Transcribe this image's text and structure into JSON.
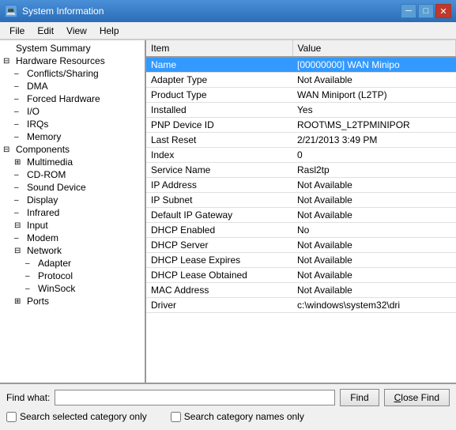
{
  "titleBar": {
    "icon": "💻",
    "title": "System Information",
    "minimizeLabel": "─",
    "maximizeLabel": "□",
    "closeLabel": "✕"
  },
  "menuBar": {
    "items": [
      "File",
      "Edit",
      "View",
      "Help"
    ]
  },
  "tree": {
    "items": [
      {
        "id": "system-summary",
        "label": "System Summary",
        "indent": 1,
        "icon": ""
      },
      {
        "id": "hardware-resources",
        "label": "Hardware Resources",
        "indent": 1,
        "icon": "⊟"
      },
      {
        "id": "conflicts-sharing",
        "label": "Conflicts/Sharing",
        "indent": 2,
        "icon": "–"
      },
      {
        "id": "dma",
        "label": "DMA",
        "indent": 2,
        "icon": "–"
      },
      {
        "id": "forced-hardware",
        "label": "Forced Hardware",
        "indent": 2,
        "icon": "–"
      },
      {
        "id": "io",
        "label": "I/O",
        "indent": 2,
        "icon": "–"
      },
      {
        "id": "irqs",
        "label": "IRQs",
        "indent": 2,
        "icon": "–"
      },
      {
        "id": "memory",
        "label": "Memory",
        "indent": 2,
        "icon": "–"
      },
      {
        "id": "components",
        "label": "Components",
        "indent": 1,
        "icon": "⊟"
      },
      {
        "id": "multimedia",
        "label": "Multimedia",
        "indent": 2,
        "icon": "⊞"
      },
      {
        "id": "cd-rom",
        "label": "CD-ROM",
        "indent": 2,
        "icon": "–"
      },
      {
        "id": "sound-device",
        "label": "Sound Device",
        "indent": 2,
        "icon": "–"
      },
      {
        "id": "display",
        "label": "Display",
        "indent": 2,
        "icon": "–"
      },
      {
        "id": "infrared",
        "label": "Infrared",
        "indent": 2,
        "icon": "–"
      },
      {
        "id": "input",
        "label": "Input",
        "indent": 2,
        "icon": "⊟"
      },
      {
        "id": "modem",
        "label": "Modem",
        "indent": 2,
        "icon": "–"
      },
      {
        "id": "network",
        "label": "Network",
        "indent": 2,
        "icon": "⊟"
      },
      {
        "id": "adapter",
        "label": "Adapter",
        "indent": 3,
        "icon": "–"
      },
      {
        "id": "protocol",
        "label": "Protocol",
        "indent": 3,
        "icon": "–"
      },
      {
        "id": "winsock",
        "label": "WinSock",
        "indent": 3,
        "icon": "–"
      },
      {
        "id": "ports",
        "label": "Ports",
        "indent": 2,
        "icon": "⊞"
      }
    ]
  },
  "table": {
    "columns": [
      {
        "id": "item",
        "label": "Item"
      },
      {
        "id": "value",
        "label": "Value"
      }
    ],
    "rows": [
      {
        "item": "Name",
        "value": "[00000000] WAN Minipo",
        "highlighted": true
      },
      {
        "item": "Adapter Type",
        "value": "Not Available",
        "highlighted": false
      },
      {
        "item": "Product Type",
        "value": "WAN Miniport (L2TP)",
        "highlighted": false
      },
      {
        "item": "Installed",
        "value": "Yes",
        "highlighted": false
      },
      {
        "item": "PNP Device ID",
        "value": "ROOT\\MS_L2TPMINIPOR",
        "highlighted": false
      },
      {
        "item": "Last Reset",
        "value": "2/21/2013 3:49 PM",
        "highlighted": false
      },
      {
        "item": "Index",
        "value": "0",
        "highlighted": false
      },
      {
        "item": "Service Name",
        "value": "Rasl2tp",
        "highlighted": false
      },
      {
        "item": "IP Address",
        "value": "Not Available",
        "highlighted": false
      },
      {
        "item": "IP Subnet",
        "value": "Not Available",
        "highlighted": false
      },
      {
        "item": "Default IP Gateway",
        "value": "Not Available",
        "highlighted": false
      },
      {
        "item": "DHCP Enabled",
        "value": "No",
        "highlighted": false
      },
      {
        "item": "DHCP Server",
        "value": "Not Available",
        "highlighted": false
      },
      {
        "item": "DHCP Lease Expires",
        "value": "Not Available",
        "highlighted": false
      },
      {
        "item": "DHCP Lease Obtained",
        "value": "Not Available",
        "highlighted": false
      },
      {
        "item": "MAC Address",
        "value": "Not Available",
        "highlighted": false
      },
      {
        "item": "Driver",
        "value": "c:\\windows\\system32\\dri",
        "highlighted": false
      }
    ]
  },
  "findBar": {
    "findWhatLabel": "Find what:",
    "findButtonLabel": "Find",
    "closeButtonLabel": "Close Find",
    "checkbox1Label": "Search selected category only",
    "checkbox2Label": "Search category names only"
  }
}
